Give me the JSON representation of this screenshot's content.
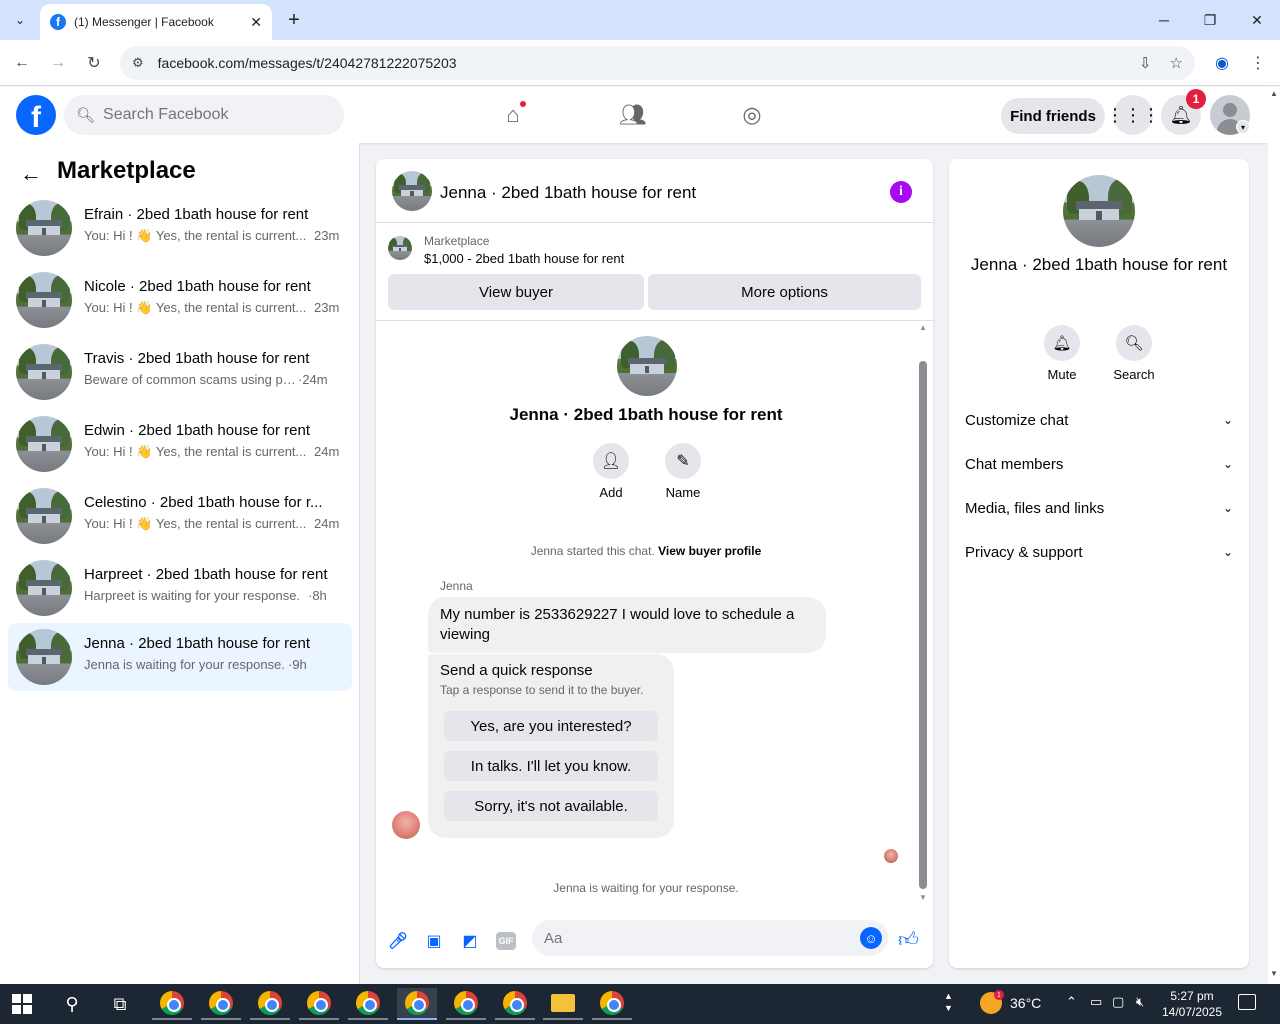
{
  "browser": {
    "tab_title": "(1) Messenger | Facebook",
    "url": "facebook.com/messages/t/24042781222075203"
  },
  "fb_header": {
    "search_placeholder": "Search Facebook",
    "find_friends_label": "Find friends",
    "notification_count": "1",
    "brand_color": "#0866ff"
  },
  "sidebar": {
    "title": "Marketplace",
    "conversations": [
      {
        "name": "Efrain · 2bed 1bath house for rent",
        "preview": "You: Hi ! 👋 Yes, the rental is current...",
        "time": "23m"
      },
      {
        "name": "Nicole · 2bed 1bath house for rent",
        "preview": "You: Hi ! 👋 Yes, the rental is current...",
        "time": "23m"
      },
      {
        "name": "Travis · 2bed 1bath house for rent",
        "preview": "Beware of common scams using pa...",
        "time": "·24m"
      },
      {
        "name": "Edwin · 2bed 1bath house for rent",
        "preview": "You: Hi ! 👋 Yes, the rental is current...",
        "time": "24m"
      },
      {
        "name": "Celestino · 2bed 1bath house for r...",
        "preview": "You: Hi ! 👋 Yes, the rental is current...",
        "time": "24m"
      },
      {
        "name": "Harpreet · 2bed 1bath house for rent",
        "preview": "Harpreet is waiting for your response.",
        "time": "·8h"
      },
      {
        "name": "Jenna · 2bed 1bath house for rent",
        "preview": "Jenna is waiting for your response.",
        "time": "·9h"
      }
    ]
  },
  "chat": {
    "title": "Jenna · 2bed 1bath house for rent",
    "listing_label": "Marketplace",
    "listing_price": "$1,000 - 2bed 1bath house for rent",
    "view_buyer_label": "View buyer",
    "more_options_label": "More options",
    "intro_title": "Jenna · 2bed 1bath house for rent",
    "add_label": "Add",
    "name_label": "Name",
    "started_text": "Jenna started this chat.",
    "view_profile_link": "View buyer profile",
    "sender_name": "Jenna",
    "message": "My number is 2533629227 I would love to schedule a viewing",
    "quick_title": "Send a quick response",
    "quick_subtitle": "Tap a response to send it to the buyer.",
    "quick_responses": [
      "Yes, are you interested?",
      "In talks. I'll let you know.",
      "Sorry, it's not available."
    ],
    "waiting_text": "Jenna is waiting for your response.",
    "composer_placeholder": "Aa",
    "gif_label": "GIF"
  },
  "details": {
    "title": "Jenna · 2bed 1bath house for rent",
    "mute_label": "Mute",
    "search_label": "Search",
    "sections": [
      "Customize chat",
      "Chat members",
      "Media, files and links",
      "Privacy & support"
    ]
  },
  "taskbar": {
    "temperature": "36°C",
    "time": "5:27 pm",
    "date": "14/07/2025",
    "weather_badge": "1"
  }
}
